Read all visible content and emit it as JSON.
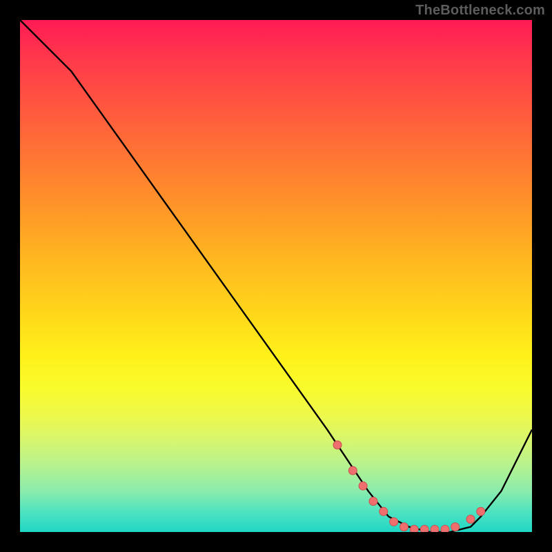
{
  "attribution": "TheBottleneck.com",
  "colors": {
    "page_bg": "#000000",
    "curve": "#000000",
    "marker_fill": "#ef6e6e",
    "marker_stroke": "#c94f4f"
  },
  "chart_data": {
    "type": "line",
    "title": "",
    "xlabel": "",
    "ylabel": "",
    "xlim": [
      0,
      100
    ],
    "ylim": [
      0,
      100
    ],
    "grid": false,
    "legend": false,
    "x": [
      0,
      6,
      10,
      20,
      30,
      40,
      50,
      60,
      64,
      68,
      72,
      76,
      80,
      84,
      88,
      90,
      94,
      100
    ],
    "values": [
      100,
      94,
      90,
      76,
      62,
      48,
      34,
      20,
      14,
      8,
      3,
      1,
      0,
      0,
      1,
      3,
      8,
      20
    ],
    "markers_x": [
      62,
      65,
      67,
      69,
      71,
      73,
      75,
      77,
      79,
      81,
      83,
      85,
      88,
      90
    ],
    "markers_y": [
      17,
      12,
      9,
      6,
      4,
      2,
      1,
      0.5,
      0.5,
      0.5,
      0.5,
      1,
      2.5,
      4
    ]
  }
}
